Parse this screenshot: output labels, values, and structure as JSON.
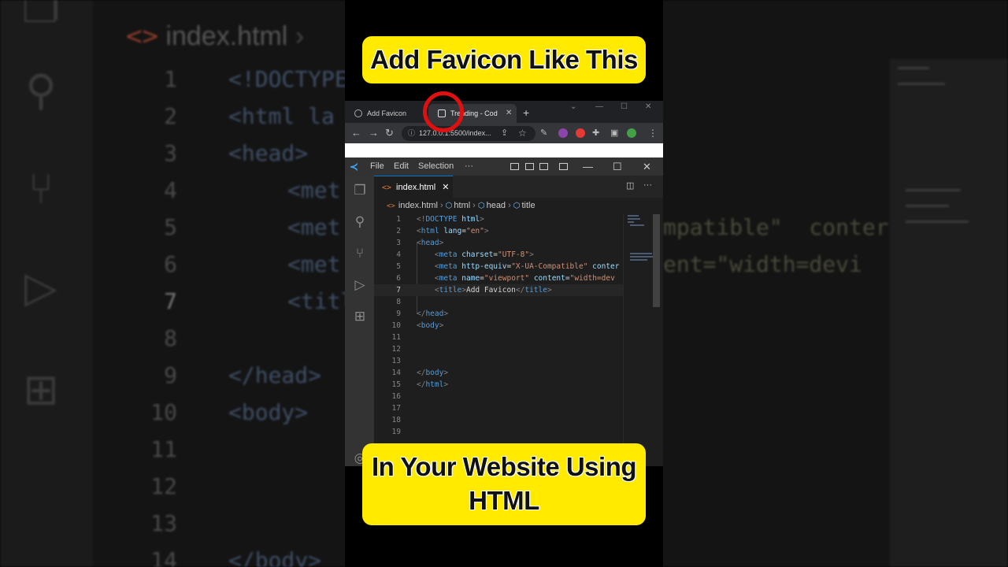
{
  "captions": {
    "top": "Add Favicon Like This",
    "bottom_line1": "In Your Website Using",
    "bottom_line2": "HTML"
  },
  "browser": {
    "tabs": [
      {
        "label": "Add Favicon"
      },
      {
        "label": "Trending - Codel"
      }
    ],
    "new_tab": "+",
    "url": "127.0.0.1:5500/index..."
  },
  "vscode": {
    "menu": [
      "File",
      "Edit",
      "Selection",
      "···"
    ],
    "tab_label": "index.html",
    "breadcrumb": [
      "index.html",
      "html",
      "head",
      "title"
    ],
    "line_numbers": [
      "1",
      "2",
      "3",
      "4",
      "5",
      "6",
      "7",
      "8",
      "9",
      "10",
      "11",
      "12",
      "13",
      "14",
      "15",
      "16",
      "17",
      "18",
      "19"
    ]
  },
  "background": {
    "tab": "index.html",
    "line_numbers": [
      "1",
      "2",
      "3",
      "4",
      "5",
      "6",
      "7",
      "8",
      "9",
      "10",
      "11",
      "12",
      "13",
      "14"
    ],
    "code": [
      "<!DOCTYPE",
      "<html la",
      "<head>",
      "<met",
      "<met",
      "<met",
      "<titl",
      "",
      "</head>",
      "<body>",
      "",
      "",
      "",
      "</body>"
    ],
    "right": [
      "",
      "",
      "",
      "",
      "mpatible\"  conter",
      "ent=\"width=devi"
    ]
  },
  "colors": {
    "caption_bg": "#ffea00",
    "annotation_circle": "#e01010",
    "vscode_bg": "#1e1e1e",
    "tag_blue": "#569cd6",
    "attr_lightblue": "#9cdcfe",
    "string_orange": "#ce9178"
  }
}
